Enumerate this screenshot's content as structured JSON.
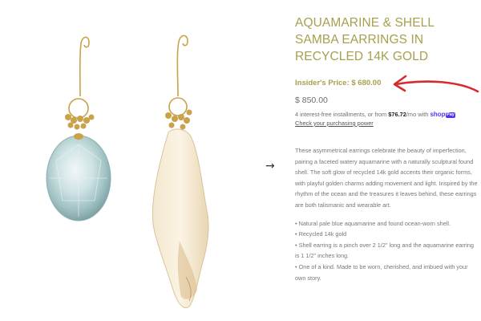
{
  "product": {
    "title_lines": [
      "AQUAMARINE & SHELL",
      "SAMBA EARRINGS IN",
      "RECYCLED 14K GOLD"
    ],
    "insider_price": "Insider's Price: $ 680.00",
    "price": "$ 850.00",
    "installments_prefix": "4 interest-free installments, or from ",
    "installments_amount": "$76.72",
    "installments_suffix": "/mo with ",
    "shop_word": "shop",
    "shop_pay": "Pay",
    "check_link": "Check your purchasing power",
    "description": "These asymmetrical earrings celebrate the beauty of imperfection, pairing a faceted watery aquamarine with a naturally sculptural found shell. The soft glow of recycled 14k gold accents their organic forms, with playful golden charms adding movement and light. Inspired by the rhythm of the ocean and the treasures it leaves behind, these earrings are both talismanic and wearable art.",
    "bullets": [
      "• Natural pale blue aquamarine and found ocean-worn shell.",
      "• Recycled 14k gold",
      "• Shell earring is a pinch over 2 1/2\" long and the aquamarine earring is 1 1/2\" inches long.",
      "• One of a kind. Made to be worn, cherished, and imbued with your own story."
    ]
  },
  "gallery": {
    "next_icon": "→"
  },
  "colors": {
    "accent_gold": "#a7a04f",
    "annotation_red": "#d62b2b",
    "shop_pay_purple": "#5a31f4"
  }
}
